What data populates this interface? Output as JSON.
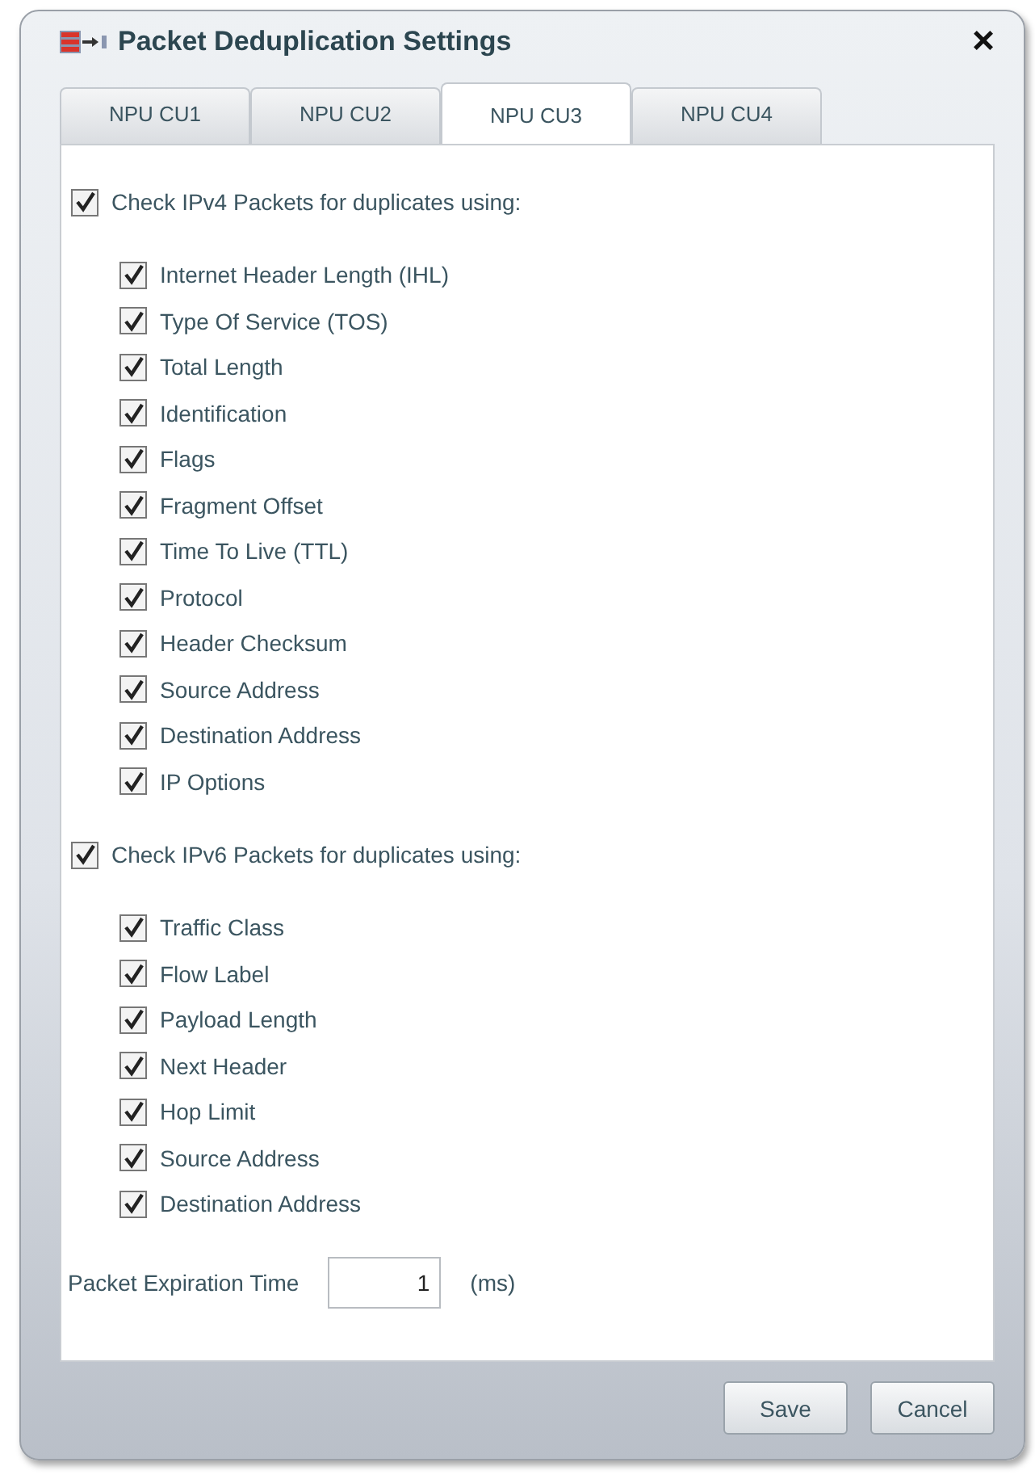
{
  "window": {
    "title": "Packet Deduplication Settings",
    "close": "×"
  },
  "tabs": [
    {
      "label": "NPU CU1",
      "selected": false
    },
    {
      "label": "NPU CU2",
      "selected": false
    },
    {
      "label": "NPU CU3",
      "selected": true
    },
    {
      "label": "NPU CU4",
      "selected": false
    }
  ],
  "groups": [
    {
      "label": "Check IPv4 Packets for duplicates using:",
      "checked": true,
      "items": [
        {
          "label": "Internet Header Length (IHL)",
          "checked": true
        },
        {
          "label": "Type Of Service (TOS)",
          "checked": true
        },
        {
          "label": "Total Length",
          "checked": true
        },
        {
          "label": "Identification",
          "checked": true
        },
        {
          "label": "Flags",
          "checked": true
        },
        {
          "label": "Fragment Offset",
          "checked": true
        },
        {
          "label": "Time To Live (TTL)",
          "checked": true
        },
        {
          "label": "Protocol",
          "checked": true
        },
        {
          "label": "Header Checksum",
          "checked": true
        },
        {
          "label": "Source Address",
          "checked": true
        },
        {
          "label": "Destination Address",
          "checked": true
        },
        {
          "label": "IP Options",
          "checked": true
        }
      ]
    },
    {
      "label": "Check IPv6 Packets for duplicates using:",
      "checked": true,
      "items": [
        {
          "label": "Traffic Class",
          "checked": true
        },
        {
          "label": "Flow Label",
          "checked": true
        },
        {
          "label": "Payload Length",
          "checked": true
        },
        {
          "label": "Next Header",
          "checked": true
        },
        {
          "label": "Hop Limit",
          "checked": true
        },
        {
          "label": "Source Address",
          "checked": true
        },
        {
          "label": "Destination Address",
          "checked": true
        }
      ]
    }
  ],
  "expiration": {
    "label": "Packet Expiration Time",
    "value": "1",
    "unit": "(ms)"
  },
  "buttons": [
    "Save",
    "Cancel"
  ]
}
